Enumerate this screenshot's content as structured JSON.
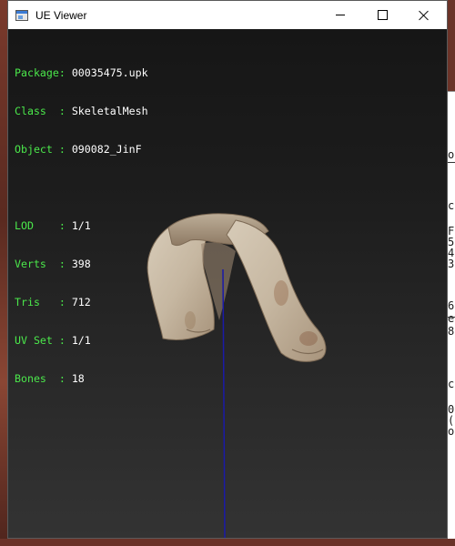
{
  "window": {
    "title": "UE Viewer"
  },
  "info_panel": {
    "group1": [
      {
        "key": "Package:",
        "value": " 00035475.upk"
      },
      {
        "key": "Class  :",
        "value": " SkeletalMesh"
      },
      {
        "key": "Object :",
        "value": " 090082_JinF"
      }
    ],
    "group2": [
      {
        "key": "LOD    :",
        "value": " 1/1"
      },
      {
        "key": "Verts  :",
        "value": " 398"
      },
      {
        "key": "Tris   :",
        "value": " 712"
      },
      {
        "key": "UV Set :",
        "value": " 1/1"
      },
      {
        "key": "Bones  :",
        "value": " 18"
      }
    ]
  },
  "side_terminal": {
    "chars": [
      "o",
      "c",
      "F",
      "5",
      "4",
      "3",
      "6",
      "e",
      "8",
      "c",
      "0",
      "(",
      "o"
    ]
  },
  "colors": {
    "label_green": "#4be84b",
    "value_white": "#ffffff",
    "bone_line_blue": "#1a1aa8",
    "mesh_cloth": "#c9bba6"
  },
  "icons": {
    "app": "app-window-icon",
    "minimize": "minimize-icon",
    "maximize": "maximize-icon",
    "close": "close-icon"
  }
}
